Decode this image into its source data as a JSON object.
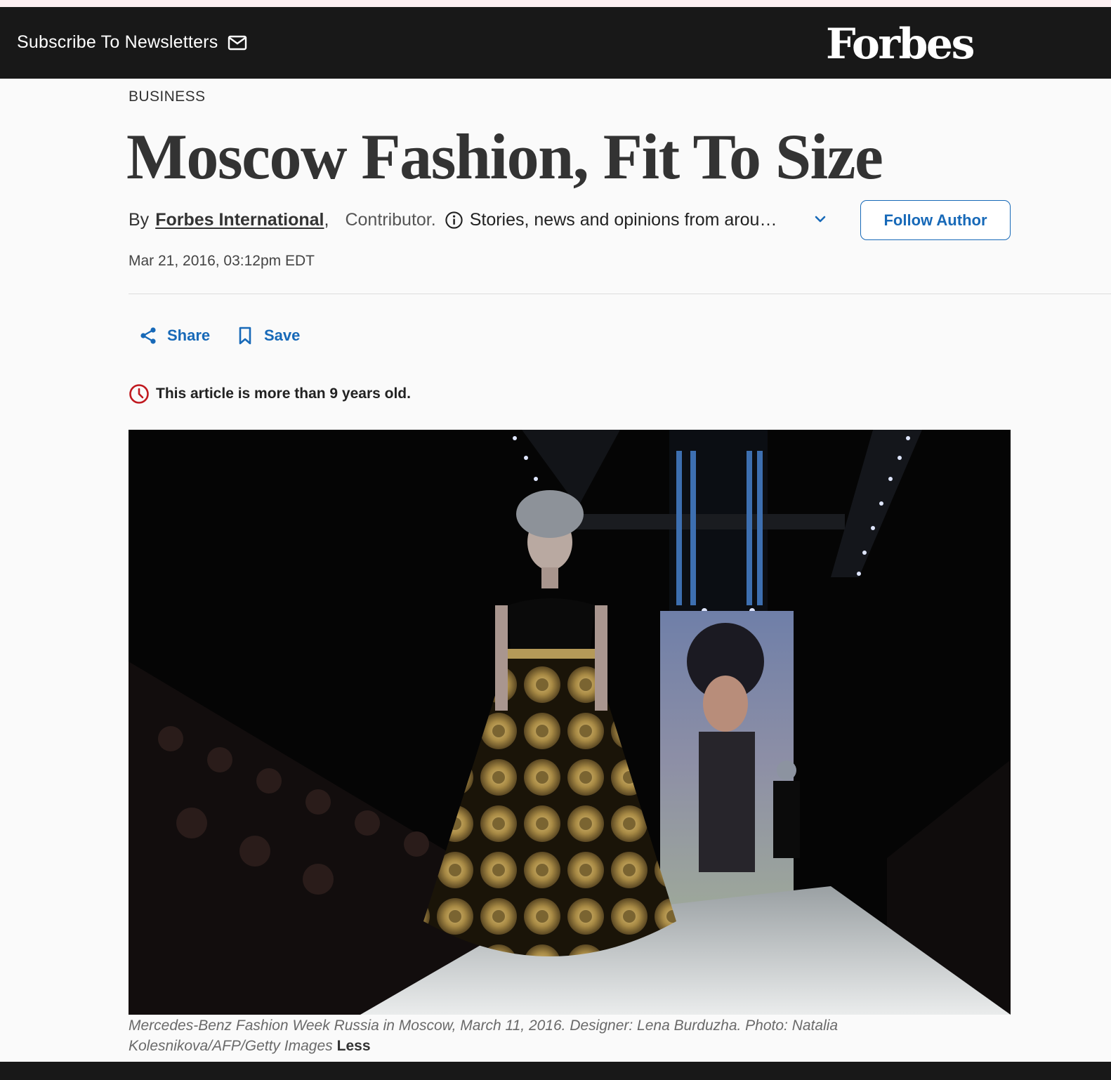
{
  "header": {
    "subscribe_label": "Subscribe To Newsletters",
    "logo_text": "Forbes"
  },
  "article": {
    "category": "BUSINESS",
    "title": "Moscow Fashion, Fit To Size",
    "byline": {
      "by": "By",
      "author": "Forbes International",
      "comma": ",",
      "role": "Contributor.",
      "bio": "Stories, news and opinions from around the world."
    },
    "follow_label": "Follow Author",
    "date": "Mar 21, 2016, 03:12pm EDT",
    "actions": {
      "share_label": "Share",
      "save_label": "Save"
    },
    "age_notice": "This article is more than 9 years old.",
    "image": {
      "caption": "Mercedes-Benz Fashion Week Russia in Moscow, March 11, 2016. Designer: Lena Burduzha. Photo: Natalia Kolesnikova/AFP/Getty Images",
      "less_label": "Less"
    }
  },
  "colors": {
    "topbar": "#181818",
    "accent_blue": "#1769b8",
    "alert_red": "#c0191f",
    "background": "#fafafa"
  },
  "icons": [
    "mail-icon",
    "info-icon",
    "chevron-down-icon",
    "share-icon",
    "bookmark-icon",
    "clock-icon"
  ]
}
